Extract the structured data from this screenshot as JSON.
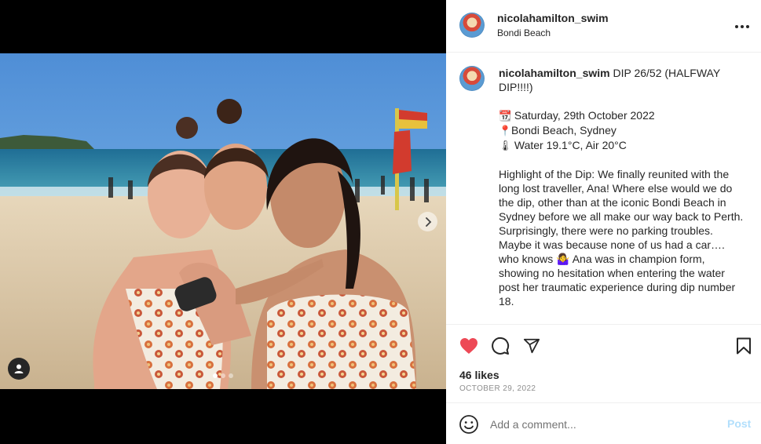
{
  "post": {
    "username": "nicolahamilton_swim",
    "location": "Bondi Beach",
    "caption": {
      "username": "nicolahamilton_swim",
      "title": " DIP 26/52 (HALFWAY DIP!!!!)",
      "lines": [
        {
          "icon": "calendar-icon",
          "emoji": "📆",
          "text": "Saturday, 29th October 2022"
        },
        {
          "icon": "pin-icon",
          "emoji": "📍",
          "text": "Bondi Beach, Sydney"
        },
        {
          "icon": "thermometer-icon",
          "emoji": "🌡",
          "text": "Water 19.1°C, Air 20°C"
        }
      ],
      "body_before_emoji": "Highlight of the Dip: We finally reunited with the long lost traveller, Ana! Where else would we do the dip, other than at the iconic Bondi Beach in Sydney before we all make our way back to Perth. Surprisingly, there were no parking troubles. Maybe it was because none of us had a car…. who knows ",
      "body_emoji": "🤷‍♀️",
      "body_after_emoji": " Ana was in champion form, showing no hesitation when entering the water post her traumatic experience during dip number 18."
    },
    "likes": "46 likes",
    "date": "OCTOBER 29, 2022",
    "comment_placeholder": "Add a comment...",
    "post_label": "Post",
    "carousel": {
      "count": 3,
      "active_index": 0
    },
    "liked": true
  },
  "colors": {
    "like_red": "#ed4956",
    "post_disabled": "#b2dffc",
    "muted": "#8e8e8e",
    "divider": "#efefef"
  }
}
